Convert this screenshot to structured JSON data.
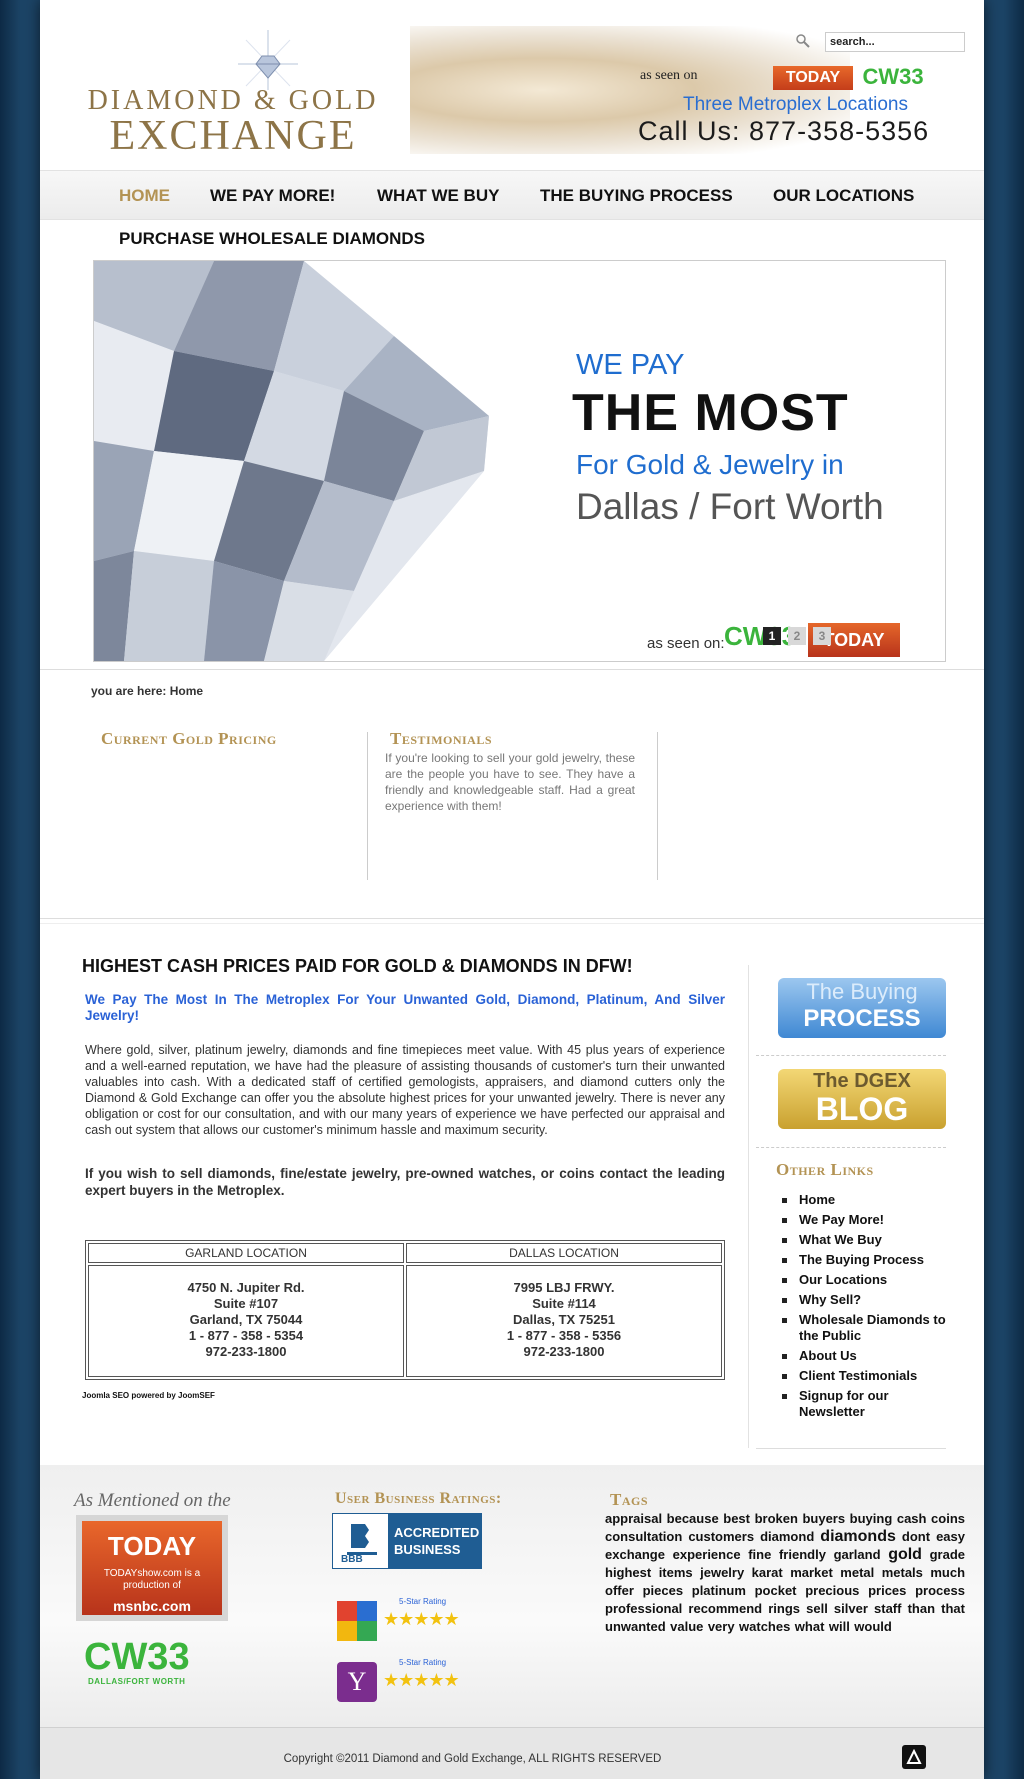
{
  "header": {
    "logo_line1": "DIAMOND & GOLD",
    "logo_line2": "EXCHANGE",
    "search_placeholder": "search...",
    "as_seen_on": "as seen on",
    "today_badge": "TODAY",
    "cw_badge": "CW33",
    "locations_tagline": "Three Metroplex Locations",
    "phone": "Call Us:  877-358-5356"
  },
  "nav": {
    "items": [
      {
        "label": "HOME"
      },
      {
        "label": "WE PAY MORE!"
      },
      {
        "label": "WHAT WE BUY"
      },
      {
        "label": "THE BUYING PROCESS"
      },
      {
        "label": "OUR LOCATIONS"
      }
    ],
    "second_row": "PURCHASE WHOLESALE DIAMONDS"
  },
  "banner": {
    "line1": "WE PAY",
    "line2": "THE MOST",
    "line3": "For Gold & Jewelry in",
    "line4": "Dallas / Fort Worth",
    "as_seen_on": "as seen on:",
    "cw": "CW33",
    "today": "TODAY",
    "slides": [
      "1",
      "2",
      "3"
    ]
  },
  "breadcrumb": "you are here: Home",
  "modules": {
    "gold_pricing_title": "Current Gold Pricing",
    "testimonials_title": "Testimonials",
    "testimonial_text": "If you're looking to sell your gold jewelry, these are the people you have to see. They have a friendly and knowledgeable staff. Had a great experience with them!"
  },
  "main": {
    "title": "HIGHEST CASH PRICES PAID FOR GOLD & DIAMONDS IN DFW!",
    "subtitle": "We Pay The Most In The Metroplex For Your Unwanted Gold, Diamond, Platinum, And Silver Jewelry!",
    "body": "Where gold, silver, platinum jewelry, diamonds and fine timepieces meet value. With 45 plus years of experience and a well-earned reputation, we have had the pleasure of assisting thousands of customer's turn their unwanted valuables into cash. With a dedicated staff of certified gemologists, appraisers, and diamond cutters only the Diamond & Gold Exchange can offer you the absolute highest prices for your unwanted jewelry. There is never any obligation or cost for our consultation, and with our many years of experience we have perfected our appraisal and cash out system that allows our customer's minimum hassle and maximum security.",
    "contact": "If you wish to sell diamonds, fine/estate jewelry, pre-owned watches, or coins contact the leading expert buyers in the Metroplex.",
    "locations": [
      {
        "header": "GARLAND LOCATION",
        "lines": [
          "4750 N. Jupiter Rd.",
          "Suite #107",
          "Garland, TX 75044",
          "1 - 877 - 358 - 5354",
          "972-233-1800"
        ]
      },
      {
        "header": "DALLAS LOCATION",
        "lines": [
          "7995 LBJ FRWY.",
          "Suite #114",
          "Dallas, TX 75251",
          "1 - 877 - 358 - 5356",
          "972-233-1800"
        ]
      }
    ],
    "joomla_note": "Joomla SEO powered by JoomSEF"
  },
  "sidebar": {
    "buying_line1": "The Buying",
    "buying_line2": "PROCESS",
    "blog_line1": "The DGEX",
    "blog_line2": "BLOG",
    "links_title": "Other Links",
    "links": [
      {
        "label": "Home"
      },
      {
        "label": "We Pay More!"
      },
      {
        "label": "What We Buy"
      },
      {
        "label": "The Buying Process"
      },
      {
        "label": "Our Locations"
      },
      {
        "label": "Why Sell?"
      },
      {
        "label": "Wholesale Diamonds to the Public"
      },
      {
        "label": "About Us"
      },
      {
        "label": "Client Testimonials"
      },
      {
        "label": "Signup for our Newsletter"
      }
    ]
  },
  "footer": {
    "mentioned_title": "As Mentioned on the",
    "today_logo": "TODAY",
    "today_sub": "TODAYshow.com is a production of",
    "msnbc": "msnbc.com",
    "cw": "CW33",
    "cw_sub": "DALLAS/FORT WORTH",
    "ratings_title": "User Business Ratings:",
    "bbb_label": "ACCREDITED BUSINESS",
    "bbb_short": "BBB",
    "rating_caption": "5-Star Rating",
    "stars": "★★★★★",
    "tags_title": "Tags",
    "tags": [
      {
        "t": "appraisal",
        "big": false
      },
      {
        "t": "because",
        "big": false
      },
      {
        "t": "best",
        "big": false
      },
      {
        "t": "broken",
        "big": false
      },
      {
        "t": "buyers",
        "big": false
      },
      {
        "t": "buying",
        "big": false
      },
      {
        "t": "cash",
        "big": false
      },
      {
        "t": "coins",
        "big": false
      },
      {
        "t": "consultation",
        "big": false
      },
      {
        "t": "customers",
        "big": false
      },
      {
        "t": "diamond",
        "big": false
      },
      {
        "t": "diamonds",
        "big": true
      },
      {
        "t": "dont",
        "big": false
      },
      {
        "t": "easy",
        "big": false
      },
      {
        "t": "exchange",
        "big": false
      },
      {
        "t": "experience",
        "big": false
      },
      {
        "t": "fine",
        "big": false
      },
      {
        "t": "friendly",
        "big": false
      },
      {
        "t": "garland",
        "big": false
      },
      {
        "t": "gold",
        "big": true
      },
      {
        "t": "grade",
        "big": false
      },
      {
        "t": "highest",
        "big": false
      },
      {
        "t": "items",
        "big": false
      },
      {
        "t": "jewelry",
        "big": false
      },
      {
        "t": "karat",
        "big": false
      },
      {
        "t": "market",
        "big": false
      },
      {
        "t": "metal",
        "big": false
      },
      {
        "t": "metals",
        "big": false
      },
      {
        "t": "much",
        "big": false
      },
      {
        "t": "offer",
        "big": false
      },
      {
        "t": "pieces",
        "big": false
      },
      {
        "t": "platinum",
        "big": false
      },
      {
        "t": "pocket",
        "big": false
      },
      {
        "t": "precious",
        "big": false
      },
      {
        "t": "prices",
        "big": false
      },
      {
        "t": "process",
        "big": false
      },
      {
        "t": "professional",
        "big": false
      },
      {
        "t": "recommend",
        "big": false
      },
      {
        "t": "rings",
        "big": false
      },
      {
        "t": "sell",
        "big": false
      },
      {
        "t": "silver",
        "big": false
      },
      {
        "t": "staff",
        "big": false
      },
      {
        "t": "than",
        "big": false
      },
      {
        "t": "that",
        "big": false
      },
      {
        "t": "unwanted",
        "big": false
      },
      {
        "t": "value",
        "big": false
      },
      {
        "t": "very",
        "big": false
      },
      {
        "t": "watches",
        "big": false
      },
      {
        "t": "what",
        "big": false
      },
      {
        "t": "will",
        "big": false
      },
      {
        "t": "would",
        "big": false
      }
    ],
    "copyright": "Copyright ©2011 Diamond and Gold Exchange, ALL RIGHTS RESERVED"
  },
  "colors": {
    "outer_bg": "#1c4466",
    "gold_accent": "#b39354",
    "link_blue": "#2a62d6",
    "today_orange": "#e5672a",
    "cw_green": "#3bb43c"
  }
}
